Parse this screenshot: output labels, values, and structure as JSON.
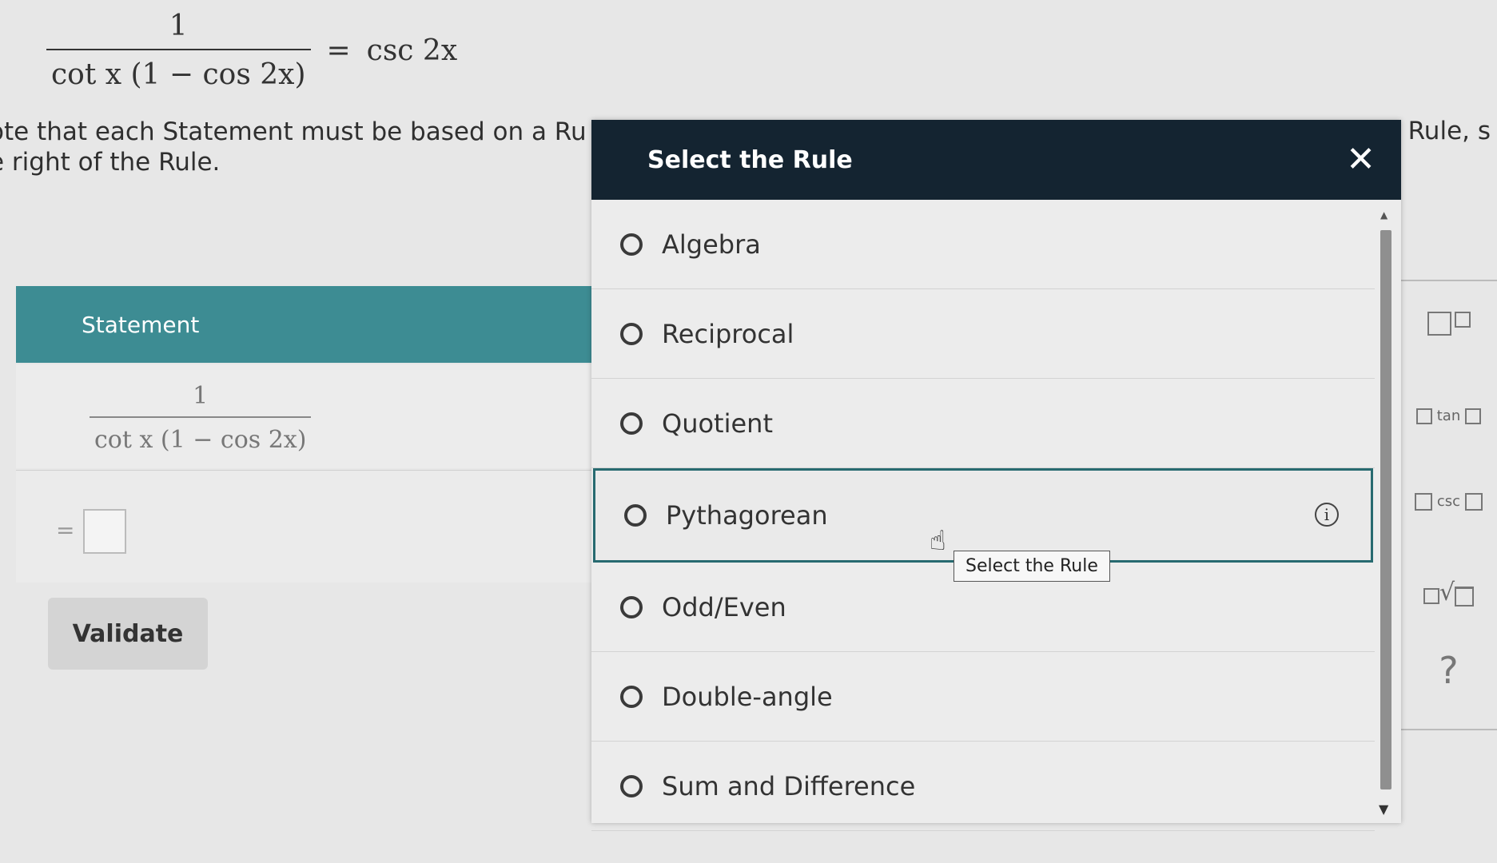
{
  "header": {
    "equation": {
      "numerator": "1",
      "denominator": "cot x (1 − cos 2x)",
      "equals": "=",
      "rhs": "csc 2x"
    },
    "note_line1": "ote that each Statement must be based on a Ru",
    "note_line2": "e right of the Rule.",
    "note_right": "Rule, s"
  },
  "table": {
    "statement_header": "Statement",
    "row1": {
      "numerator": "1",
      "denominator": "cot x (1 − cos 2x)"
    },
    "row2": {
      "equals": "="
    }
  },
  "validate_label": "Validate",
  "palette": {
    "tan_label": "tan",
    "csc_label": "csc",
    "help": "?"
  },
  "modal": {
    "title": "Select the Rule",
    "close_label": "✕",
    "options": [
      {
        "label": "Algebra"
      },
      {
        "label": "Reciprocal"
      },
      {
        "label": "Quotient"
      },
      {
        "label": "Pythagorean"
      },
      {
        "label": "Odd/Even"
      },
      {
        "label": "Double-angle"
      },
      {
        "label": "Sum and Difference"
      }
    ],
    "selected_index": 3,
    "info_label": "i",
    "tooltip": "Select the Rule"
  },
  "icons": {
    "cursor": "hand-pointer-icon",
    "info": "info-icon",
    "close": "close-icon"
  },
  "colors": {
    "modal_header": "#142431",
    "statement_header": "#3d8c93",
    "selected_border": "#276a70"
  }
}
